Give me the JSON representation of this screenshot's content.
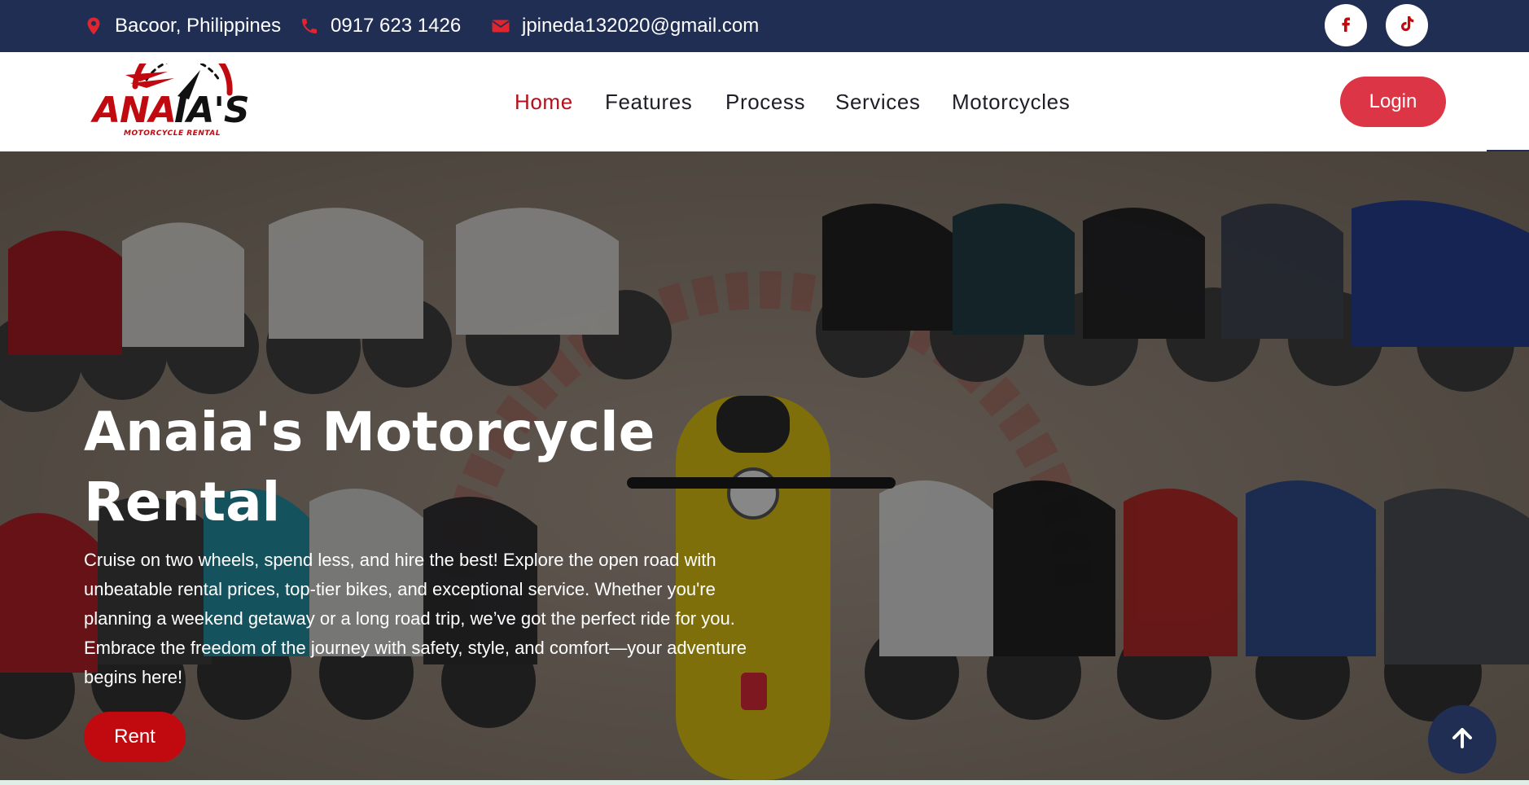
{
  "topbar": {
    "location": "Bacoor, Philippines",
    "phone": "0917 623 1426",
    "email": "jpineda132020@gmail.com",
    "location_icon": "map-marker-icon",
    "phone_icon": "phone-icon",
    "email_icon": "envelope-icon",
    "social": [
      "facebook-icon",
      "tiktok-icon"
    ]
  },
  "brand": {
    "logo_text": "ANAIA'S",
    "logo_subtext": "MOTORCYCLE RENTAL"
  },
  "nav": {
    "items": [
      {
        "label": "Home",
        "active": true
      },
      {
        "label": "Features",
        "active": false
      },
      {
        "label": "Process",
        "active": false
      },
      {
        "label": "Services",
        "active": false
      },
      {
        "label": "Motorcycles",
        "active": false
      }
    ],
    "login_label": "Login"
  },
  "hero": {
    "title": "Anaia's Motorcycle Rental",
    "description": "Cruise on two wheels, spend less, and hire the best! Explore the open road with unbeatable rental prices, top-tier bikes, and exceptional service. Whether you're planning a weekend getaway or a long road trip, we’ve got the perfect ride for you. Embrace the freedom of the journey with safety, style, and comfort—your adventure begins here!",
    "cta_label": "Rent",
    "background_image": "motorcycle-lineup-photo"
  },
  "back_to_top_icon": "arrow-up-icon",
  "colors": {
    "topbar": "#202e54",
    "accent_red": "#dc3545",
    "active_link": "#b3101b",
    "rent_button": "#c00a0f"
  }
}
